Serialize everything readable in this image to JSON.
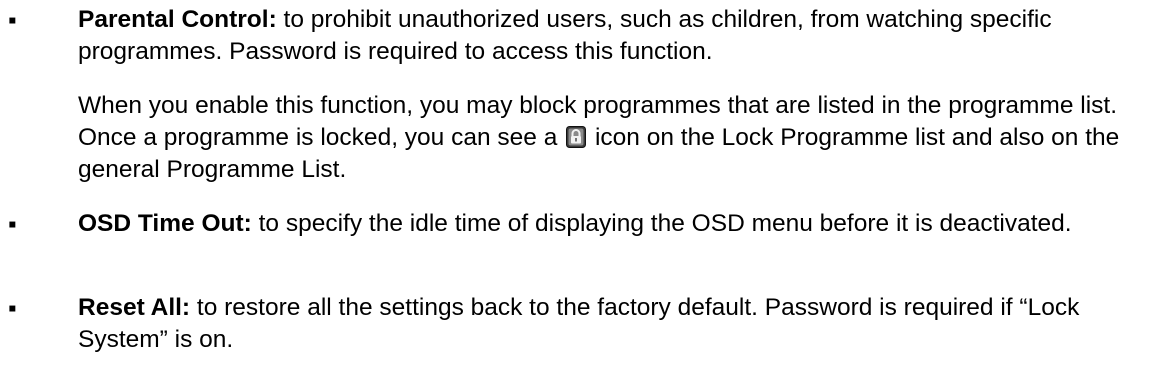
{
  "bullet_char": "▪",
  "items": [
    {
      "term": "Parental Control:",
      "description": " to prohibit unauthorized users, such as children, from watching specific programmes. Password is required to access this function.",
      "extra_paragraph": {
        "before_icon": "When you enable this function, you may block programmes that are listed in the programme list. Once a programme is locked, you can see a ",
        "icon": "lock-icon",
        "after_icon": " icon on the Lock Programme list and also on the general Programme List."
      }
    },
    {
      "term": "OSD Time Out:",
      "description": " to specify the idle time of displaying the OSD menu before it is deactivated."
    },
    {
      "term": "Reset All:",
      "description": " to restore all the settings back to the factory default. Password is required if “Lock System” is on."
    }
  ]
}
